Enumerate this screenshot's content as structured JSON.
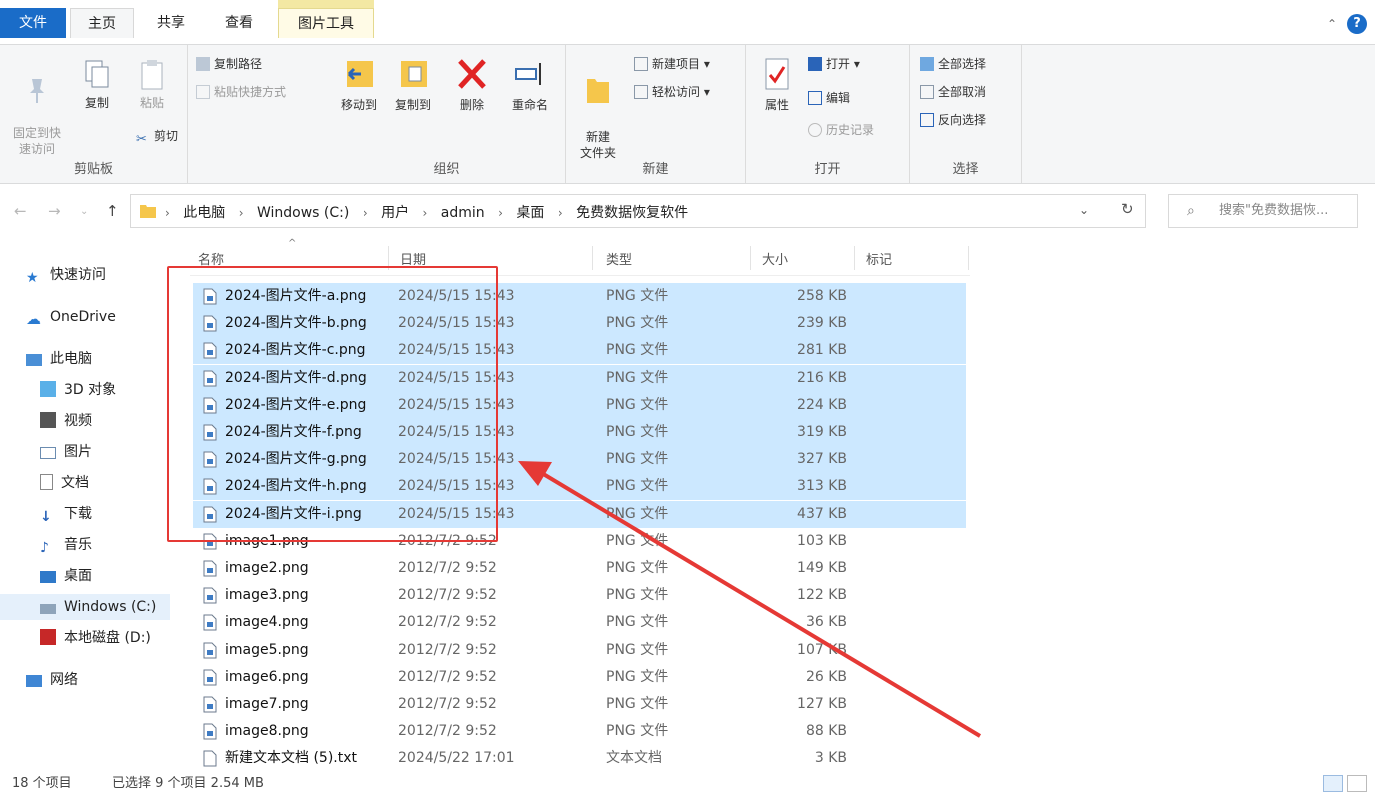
{
  "tabs": {
    "file": "文件",
    "home": "主页",
    "share": "共享",
    "view": "查看",
    "picture_tools": "图片工具"
  },
  "ribbon": {
    "clipboard": {
      "label": "剪贴板",
      "pin": "固定到快\n速访问",
      "copy": "复制",
      "paste": "粘贴",
      "copy_path": "复制路径",
      "paste_shortcut": "粘贴快捷方式",
      "cut": "剪切"
    },
    "organize": {
      "label": "组织",
      "move_to": "移动到",
      "copy_to": "复制到",
      "delete": "删除",
      "rename": "重命名"
    },
    "new": {
      "label": "新建",
      "new_folder": "新建\n文件夹",
      "new_item": "新建项目",
      "easy_access": "轻松访问"
    },
    "open": {
      "label": "打开",
      "properties": "属性",
      "open": "打开",
      "edit": "编辑",
      "history": "历史记录"
    },
    "select": {
      "label": "选择",
      "select_all": "全部选择",
      "select_none": "全部取消",
      "invert": "反向选择"
    }
  },
  "address": {
    "crumbs": [
      "此电脑",
      "Windows (C:)",
      "用户",
      "admin",
      "桌面",
      "免费数据恢复软件"
    ],
    "search_placeholder": "搜索\"免费数据恢..."
  },
  "nav": {
    "quick_access": "快速访问",
    "onedrive": "OneDrive",
    "this_pc": "此电脑",
    "objects3d": "3D 对象",
    "videos": "视频",
    "pictures": "图片",
    "documents": "文档",
    "downloads": "下载",
    "music": "音乐",
    "desktop": "桌面",
    "windows_c": "Windows (C:)",
    "local_d": "本地磁盘 (D:)",
    "network": "网络"
  },
  "columns": {
    "name": "名称",
    "date": "日期",
    "type": "类型",
    "size": "大小",
    "tags": "标记"
  },
  "files": [
    {
      "name": "2024-图片文件-a.png",
      "date": "2024/5/15 15:43",
      "type": "PNG 文件",
      "size": "258 KB",
      "selected": true
    },
    {
      "name": "2024-图片文件-b.png",
      "date": "2024/5/15 15:43",
      "type": "PNG 文件",
      "size": "239 KB",
      "selected": true
    },
    {
      "name": "2024-图片文件-c.png",
      "date": "2024/5/15 15:43",
      "type": "PNG 文件",
      "size": "281 KB",
      "selected": true
    },
    {
      "name": "2024-图片文件-d.png",
      "date": "2024/5/15 15:43",
      "type": "PNG 文件",
      "size": "216 KB",
      "selected": true
    },
    {
      "name": "2024-图片文件-e.png",
      "date": "2024/5/15 15:43",
      "type": "PNG 文件",
      "size": "224 KB",
      "selected": true
    },
    {
      "name": "2024-图片文件-f.png",
      "date": "2024/5/15 15:43",
      "type": "PNG 文件",
      "size": "319 KB",
      "selected": true
    },
    {
      "name": "2024-图片文件-g.png",
      "date": "2024/5/15 15:43",
      "type": "PNG 文件",
      "size": "327 KB",
      "selected": true
    },
    {
      "name": "2024-图片文件-h.png",
      "date": "2024/5/15 15:43",
      "type": "PNG 文件",
      "size": "313 KB",
      "selected": true
    },
    {
      "name": "2024-图片文件-i.png",
      "date": "2024/5/15 15:43",
      "type": "PNG 文件",
      "size": "437 KB",
      "selected": true
    },
    {
      "name": "image1.png",
      "date": "2012/7/2 9:52",
      "type": "PNG 文件",
      "size": "103 KB",
      "selected": false
    },
    {
      "name": "image2.png",
      "date": "2012/7/2 9:52",
      "type": "PNG 文件",
      "size": "149 KB",
      "selected": false
    },
    {
      "name": "image3.png",
      "date": "2012/7/2 9:52",
      "type": "PNG 文件",
      "size": "122 KB",
      "selected": false
    },
    {
      "name": "image4.png",
      "date": "2012/7/2 9:52",
      "type": "PNG 文件",
      "size": "36 KB",
      "selected": false
    },
    {
      "name": "image5.png",
      "date": "2012/7/2 9:52",
      "type": "PNG 文件",
      "size": "107 KB",
      "selected": false
    },
    {
      "name": "image6.png",
      "date": "2012/7/2 9:52",
      "type": "PNG 文件",
      "size": "26 KB",
      "selected": false
    },
    {
      "name": "image7.png",
      "date": "2012/7/2 9:52",
      "type": "PNG 文件",
      "size": "127 KB",
      "selected": false
    },
    {
      "name": "image8.png",
      "date": "2012/7/2 9:52",
      "type": "PNG 文件",
      "size": "88 KB",
      "selected": false
    },
    {
      "name": "新建文本文档 (5).txt",
      "date": "2024/5/22 17:01",
      "type": "文本文档",
      "size": "3 KB",
      "selected": false
    }
  ],
  "status": {
    "count": "18 个项目",
    "selection": "已选择 9 个项目  2.54 MB"
  },
  "colors": {
    "accent": "#1a6cc8",
    "selection": "#cce8ff",
    "annotation": "#e53935"
  }
}
